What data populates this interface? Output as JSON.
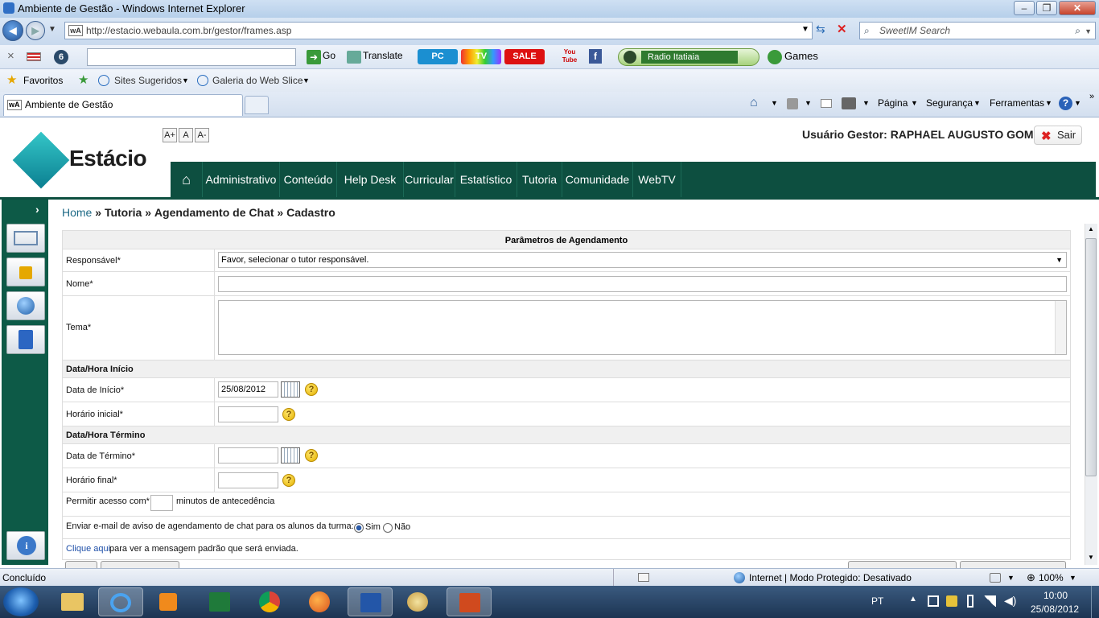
{
  "window": {
    "title": "Ambiente de Gestão - Windows Internet Explorer",
    "minimize": "–",
    "maximize": "❐",
    "close": "✕"
  },
  "address_bar": {
    "url": "http://estacio.webaula.com.br/gestor/frames.asp",
    "favicon": "wA",
    "search_placeholder": "SweetIM Search"
  },
  "toolbar": {
    "go_label": "Go",
    "translate_label": "Translate",
    "pc_label": "PC",
    "tv_label": "TV",
    "sale_label": "SALE",
    "youtube_label": "You Tube",
    "facebook_label": "f",
    "radio_label": "Radio Itatiaia",
    "games_label": "Games"
  },
  "favorites_bar": {
    "favoritos_label": "Favoritos",
    "sites_label": "Sites Sugeridos",
    "webslice_label": "Galeria do Web Slice"
  },
  "tab": {
    "title": "Ambiente de Gestão"
  },
  "command_bar": {
    "pagina": "Página",
    "seguranca": "Segurança",
    "ferramentas": "Ferramentas"
  },
  "header": {
    "logo": "Estácio",
    "font_sizes": [
      "A+",
      "A",
      "A-"
    ],
    "user_label": "Usuário Gestor: RAPHAEL AUGUSTO GOMES",
    "logout_label": "Sair",
    "nav": [
      "Administrativo",
      "Conteúdo",
      "Help Desk",
      "Curricular",
      "Estatístico",
      "Tutoria",
      "Comunidade",
      "WebTV"
    ]
  },
  "breadcrumb": {
    "home": "Home",
    "sep": "»",
    "part1": "Tutoria",
    "part2": "Agendamento de Chat",
    "part3": "Cadastro"
  },
  "form": {
    "title": "Parâmetros de Agendamento",
    "responsavel_label": "Responsável*",
    "responsavel_value": "Favor, selecionar o tutor responsável.",
    "nome_label": "Nome*",
    "nome_value": "",
    "tema_label": "Tema*",
    "section_inicio": "Data/Hora Início",
    "data_inicio_label": "Data de Início*",
    "data_inicio_value": "25/08/2012",
    "horario_inicial_label": "Horário inicial*",
    "section_termino": "Data/Hora Término",
    "data_termino_label": "Data de Término*",
    "horario_final_label": "Horário final*",
    "permitir_label": "Permitir acesso com*",
    "minutos_label": "minutos de antecedência",
    "email_label": "Enviar e-mail de aviso de agendamento de chat para os alunos da turma:",
    "sim_label": "Sim",
    "nao_label": "Não",
    "email_selected": "Sim",
    "clique_link": "Clique aqui",
    "clique_text": "para ver a mensagem padrão que será enviada."
  },
  "status_bar": {
    "status": "Concluído",
    "zone": "Internet | Modo Protegido: Desativado",
    "zoom": "100%"
  },
  "taskbar": {
    "lang": "PT",
    "time": "10:00",
    "date": "25/08/2012"
  },
  "colors": {
    "brand_green": "#0d4f40",
    "sidebar_green": "#0d5a47",
    "link_blue": "#1e6a86"
  }
}
